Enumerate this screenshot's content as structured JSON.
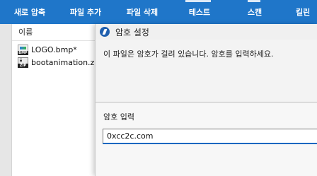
{
  "toolbar": {
    "new_zip_label": "새로 압축",
    "add_file_label": "파일 추가",
    "delete_file_label": "파일 삭제",
    "test_label": "테스트",
    "scan_label": "스캔",
    "code_page_label": "킬린 ",
    "background": "#1f76c9"
  },
  "file_list": {
    "column_name": "이름",
    "files": [
      {
        "name": "LOGO.bmp*",
        "icon": "bmp-file-icon",
        "tag": "BMP"
      },
      {
        "name": "bootanimation.zip",
        "icon": "zip-file-icon",
        "tag": "ZIP"
      }
    ]
  },
  "dialog": {
    "title": "암호 설정",
    "message": "이 파일은 암호가 걸려 있습니다. 암호를 입력하세요.",
    "password_label": "암호 입력",
    "password_value": "0xcc2c.com"
  }
}
